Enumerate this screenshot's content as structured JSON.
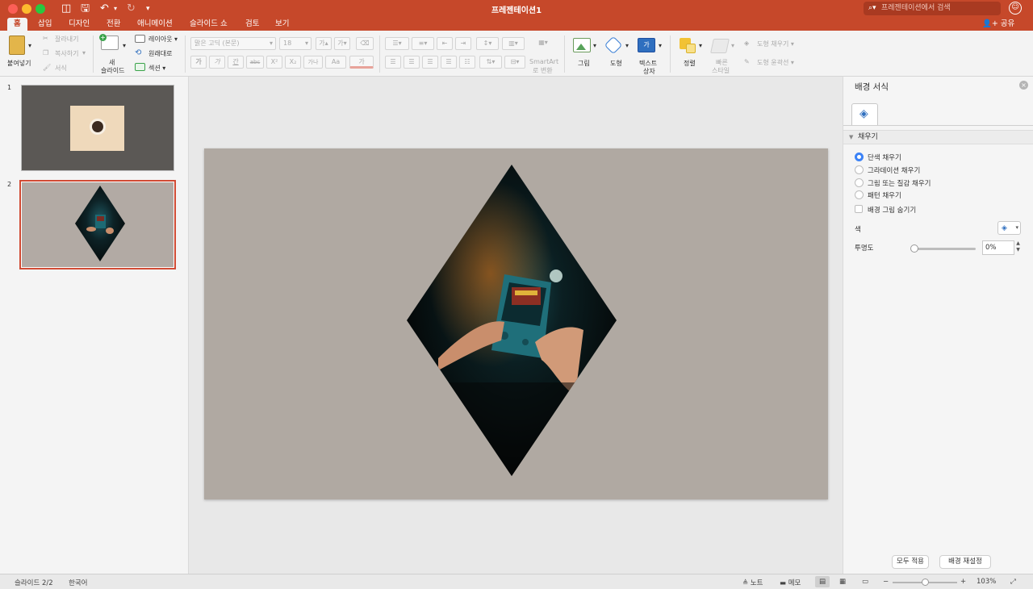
{
  "window": {
    "title": "프레젠테이션1",
    "search_placeholder": "프레젠테이션에서 검색",
    "share_label": "공유"
  },
  "tabs": [
    "홈",
    "삽입",
    "디자인",
    "전환",
    "애니메이션",
    "슬라이드 쇼",
    "검토",
    "보기"
  ],
  "active_tab": "홈",
  "ribbon": {
    "paste": "붙여넣기",
    "cut": "잘라내기",
    "copy": "복사하기",
    "format_painter": "서식",
    "new_slide_1": "새",
    "new_slide_2": "슬라이드",
    "layout": "레이아웃",
    "reset": "원래대로",
    "section": "섹션",
    "font_name": "맑은 고딕 (본문)",
    "font_size": "18",
    "grow_font": "가",
    "shrink_font": "가",
    "bold": "가",
    "italic": "가",
    "underline": "간",
    "strikethrough": "abc",
    "superscript": "X²",
    "subscript": "X₂",
    "char_spacing": "가나",
    "case": "Aa",
    "font_color": "가",
    "smartart_1": "SmartArt",
    "smartart_2": "로 변환",
    "picture": "그림",
    "shape": "도형",
    "textbox_1": "텍스트",
    "textbox_2": "상자",
    "arrange": "정렬",
    "quick_styles_1": "빠른",
    "quick_styles_2": "스타일",
    "shape_fill": "도형 채우기",
    "shape_outline": "도형 윤곽선"
  },
  "slides": [
    {
      "number": "1"
    },
    {
      "number": "2"
    }
  ],
  "panel": {
    "title": "배경 서식",
    "section_fill": "채우기",
    "options": [
      "단색 채우기",
      "그라데이션 채우기",
      "그림 또는 질감 채우기",
      "패턴 채우기"
    ],
    "selected_option": "단색 채우기",
    "hide_bg_graphics": "배경 그림 숨기기",
    "color_label": "색",
    "transparency_label": "투명도",
    "transparency_value": "0%",
    "transparency_fraction": 0.0,
    "apply_all": "모두 적용",
    "reset_bg": "배경 재설정"
  },
  "status": {
    "slide_count": "슬라이드 2/2",
    "language": "한국어",
    "notes": "노트",
    "comments": "메모",
    "zoom": "103%"
  },
  "colors": {
    "accent": "#c6482a",
    "slide_bg": "#b0a9a2",
    "selection": "#d14b34"
  }
}
